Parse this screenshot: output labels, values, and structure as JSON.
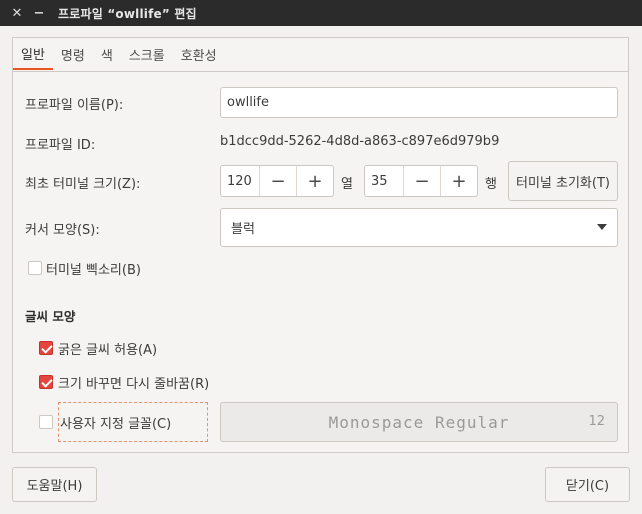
{
  "window": {
    "title": "프로파일 “owllife” 편집"
  },
  "tabs": [
    {
      "label": "일반"
    },
    {
      "label": "명령"
    },
    {
      "label": "색"
    },
    {
      "label": "스크롤"
    },
    {
      "label": "호환성"
    }
  ],
  "general": {
    "profile_name_label": "프로파일 이름(P):",
    "profile_name_value": "owllife",
    "profile_id_label": "프로파일 ID:",
    "profile_id_value": "b1dcc9dd-5262-4d8d-a863-c897e6d979b9",
    "initial_size_label": "최초 터미널 크기(Z):",
    "columns_value": "120",
    "columns_unit": "열",
    "rows_value": "35",
    "rows_unit": "행",
    "minus": "−",
    "plus": "+",
    "reset_size_button": "터미널 초기화(T)",
    "cursor_shape_label": "커서 모양(S):",
    "cursor_shape_value": "블럭",
    "terminal_bell_label": "터미널 삑소리(B)",
    "terminal_bell_checked": false
  },
  "text_appearance": {
    "section_title": "글씨 모양",
    "allow_bold_label": "굵은 글씨 허용(A)",
    "allow_bold_checked": true,
    "rewrap_label": "크기 바꾸면 다시 줄바꿈(R)",
    "rewrap_checked": true,
    "custom_font_label": "사용자 지정 글꼴(C)",
    "custom_font_checked": false,
    "font_name": "Monospace Regular",
    "font_size": "12"
  },
  "footer": {
    "help_button": "도움말(H)",
    "close_button": "닫기(C)"
  },
  "colors": {
    "accent": "#e95420",
    "checkbox_on": "#e2463d",
    "titlebar": "#2b2b2b"
  }
}
